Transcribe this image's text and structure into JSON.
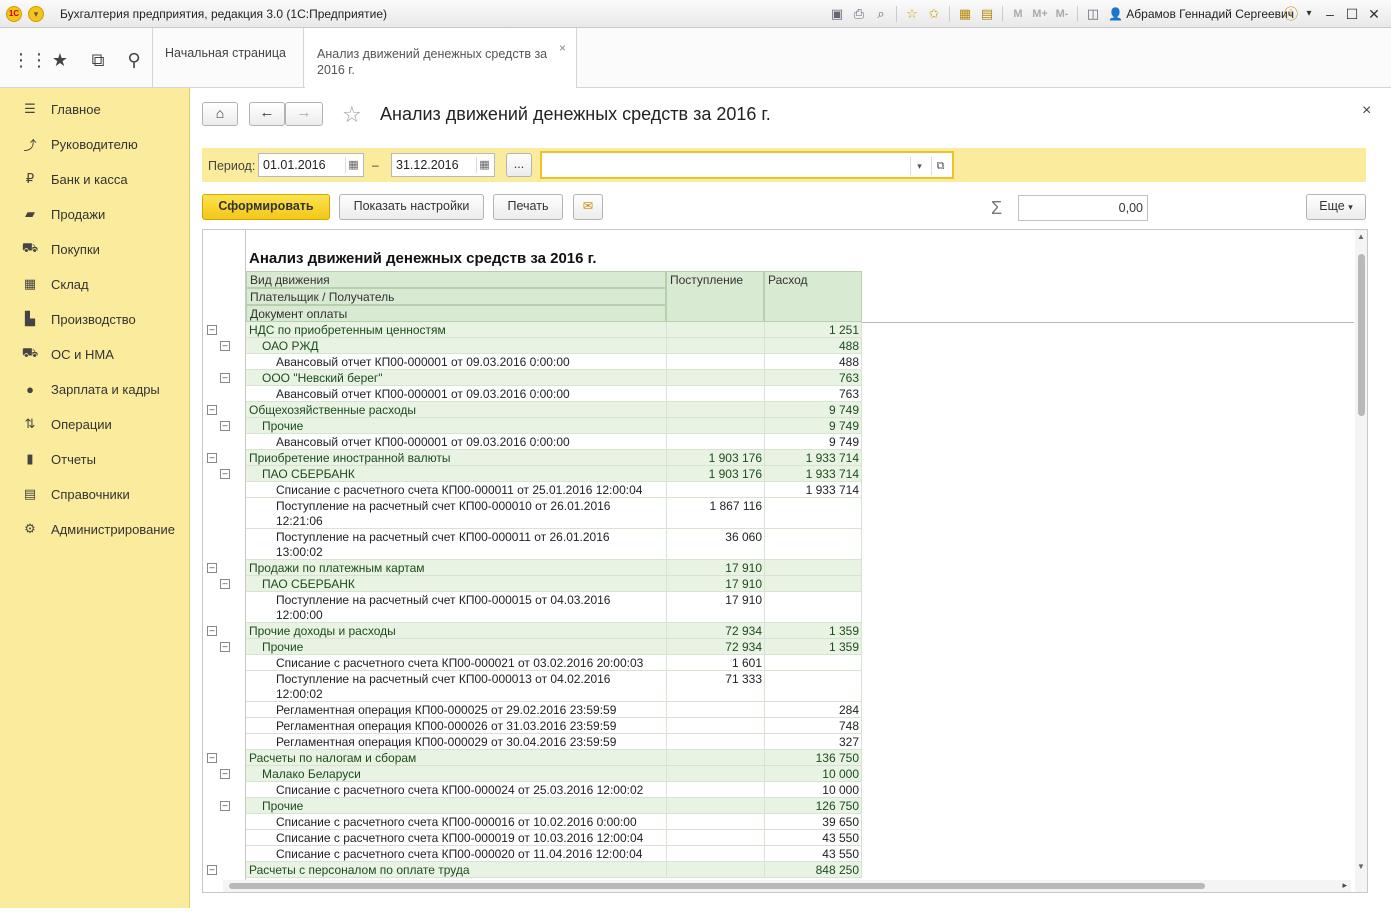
{
  "window": {
    "title": "Бухгалтерия предприятия, редакция 3.0  (1С:Предприятие)",
    "user": "Абрамов Геннадий Сергеевич",
    "icons": [
      "save-icon",
      "print-icon",
      "preview-icon",
      "favorite-add-icon",
      "favorite-icon",
      "calculator-icon",
      "calendar-icon",
      "m-icon",
      "m-plus-icon",
      "m-minus-icon",
      "panels-icon"
    ]
  },
  "tools": [
    "apps-grid-icon",
    "star-icon",
    "history-icon",
    "search-icon"
  ],
  "tabs": {
    "home": "Начальная страница",
    "active": "Анализ движений денежных средств за 2016 г."
  },
  "sidebar": {
    "items": [
      {
        "label": "Главное",
        "icon": "menu-icon"
      },
      {
        "label": "Руководителю",
        "icon": "trend-icon"
      },
      {
        "label": "Банк и касса",
        "icon": "ruble-icon"
      },
      {
        "label": "Продажи",
        "icon": "bag-icon"
      },
      {
        "label": "Покупки",
        "icon": "cart-icon"
      },
      {
        "label": "Склад",
        "icon": "warehouse-icon"
      },
      {
        "label": "Производство",
        "icon": "factory-icon"
      },
      {
        "label": "ОС и НМА",
        "icon": "truck-icon"
      },
      {
        "label": "Зарплата и кадры",
        "icon": "person-icon"
      },
      {
        "label": "Операции",
        "icon": "operations-icon"
      },
      {
        "label": "Отчеты",
        "icon": "chart-icon"
      },
      {
        "label": "Справочники",
        "icon": "books-icon"
      },
      {
        "label": "Администрирование",
        "icon": "gear-icon"
      }
    ]
  },
  "form": {
    "title": "Анализ движений денежных средств за 2016 г.",
    "period_label": "Период:",
    "date_from": "01.01.2016",
    "dash": "–",
    "date_to": "31.12.2016",
    "ellipsis": "...",
    "org_value": "",
    "btn_generate": "Сформировать",
    "btn_settings": "Показать настройки",
    "btn_print": "Печать",
    "sum_value": "0,00",
    "btn_more": "Еще"
  },
  "report": {
    "title": "Анализ движений денежных средств за 2016 г.",
    "headers": {
      "level0": "Вид движения",
      "level1": "Плательщик / Получатель",
      "level2": "Документ оплаты",
      "income": "Поступление",
      "expense": "Расход"
    },
    "rows": [
      {
        "level": 0,
        "name": "НДС по приобретенным ценностям",
        "in": "",
        "out": "1 251"
      },
      {
        "level": 1,
        "name": "ОАО РЖД",
        "in": "",
        "out": "488"
      },
      {
        "level": 2,
        "name": "Авансовый отчет КП00-000001 от 09.03.2016 0:00:00",
        "in": "",
        "out": "488"
      },
      {
        "level": 1,
        "name": "ООО \"Невский берег\"",
        "in": "",
        "out": "763"
      },
      {
        "level": 2,
        "name": "Авансовый отчет КП00-000001 от 09.03.2016 0:00:00",
        "in": "",
        "out": "763"
      },
      {
        "level": 0,
        "name": "Общехозяйственные расходы",
        "in": "",
        "out": "9 749"
      },
      {
        "level": 1,
        "name": "Прочие",
        "in": "",
        "out": "9 749"
      },
      {
        "level": 2,
        "name": "Авансовый отчет КП00-000001 от 09.03.2016 0:00:00",
        "in": "",
        "out": "9 749"
      },
      {
        "level": 0,
        "name": "Приобретение иностранной валюты",
        "in": "1 903 176",
        "out": "1 933 714"
      },
      {
        "level": 1,
        "name": "ПАО СБЕРБАНК",
        "in": "1 903 176",
        "out": "1 933 714"
      },
      {
        "level": 2,
        "name": "Списание с расчетного счета КП00-000011 от 25.01.2016 12:00:04",
        "in": "",
        "out": "1 933 714"
      },
      {
        "level": 2,
        "name": "Поступление на расчетный счет КП00-000010 от 26.01.2016\n12:21:06",
        "in": "1 867 116",
        "out": ""
      },
      {
        "level": 2,
        "name": "Поступление на расчетный счет КП00-000011 от 26.01.2016\n13:00:02",
        "in": "36 060",
        "out": ""
      },
      {
        "level": 0,
        "name": "Продажи по платежным картам",
        "in": "17 910",
        "out": ""
      },
      {
        "level": 1,
        "name": "ПАО СБЕРБАНК",
        "in": "17 910",
        "out": ""
      },
      {
        "level": 2,
        "name": "Поступление на расчетный счет КП00-000015 от 04.03.2016\n12:00:00",
        "in": "17 910",
        "out": ""
      },
      {
        "level": 0,
        "name": "Прочие доходы и расходы",
        "in": "72 934",
        "out": "1 359"
      },
      {
        "level": 1,
        "name": "Прочие",
        "in": "72 934",
        "out": "1 359"
      },
      {
        "level": 2,
        "name": "Списание с расчетного счета КП00-000021 от 03.02.2016 20:00:03",
        "in": "1 601",
        "out": ""
      },
      {
        "level": 2,
        "name": "Поступление на расчетный счет КП00-000013 от 04.02.2016\n12:00:02",
        "in": "71 333",
        "out": ""
      },
      {
        "level": 2,
        "name": "Регламентная операция КП00-000025 от 29.02.2016 23:59:59",
        "in": "",
        "out": "284"
      },
      {
        "level": 2,
        "name": "Регламентная операция КП00-000026 от 31.03.2016 23:59:59",
        "in": "",
        "out": "748"
      },
      {
        "level": 2,
        "name": "Регламентная операция КП00-000029 от 30.04.2016 23:59:59",
        "in": "",
        "out": "327"
      },
      {
        "level": 0,
        "name": "Расчеты по налогам и сборам",
        "in": "",
        "out": "136 750"
      },
      {
        "level": 1,
        "name": "Малако Беларуси",
        "in": "",
        "out": "10 000"
      },
      {
        "level": 2,
        "name": "Списание с расчетного счета КП00-000024 от 25.03.2016 12:00:02",
        "in": "",
        "out": "10 000"
      },
      {
        "level": 1,
        "name": "Прочие",
        "in": "",
        "out": "126 750"
      },
      {
        "level": 2,
        "name": "Списание с расчетного счета КП00-000016 от 10.02.2016 0:00:00",
        "in": "",
        "out": "39 650"
      },
      {
        "level": 2,
        "name": "Списание с расчетного счета КП00-000019 от 10.03.2016 12:00:04",
        "in": "",
        "out": "43 550"
      },
      {
        "level": 2,
        "name": "Списание с расчетного счета КП00-000020 от 11.04.2016 12:00:04",
        "in": "",
        "out": "43 550"
      },
      {
        "level": 0,
        "name": "Расчеты с персоналом по оплате труда",
        "in": "",
        "out": "848 250"
      }
    ]
  }
}
